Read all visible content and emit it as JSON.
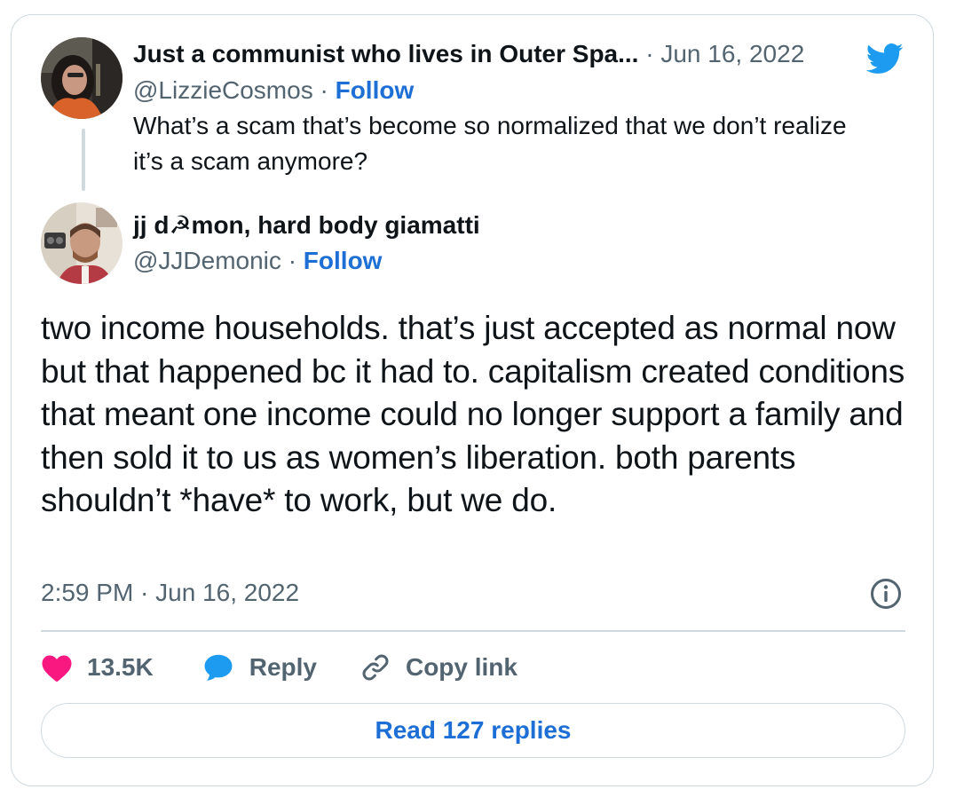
{
  "quoted": {
    "display_name": "Just a communist who lives in Outer Spa...",
    "date": "Jun 16, 2022",
    "handle": "@LizzieCosmos",
    "follow_label": "Follow",
    "text": "What’s a scam that’s become so normalized that  we don’t realize it’s a scam anymore?"
  },
  "tweet": {
    "display_name": "jj d☭mon, hard body giamatti",
    "handle": "@JJDemonic",
    "follow_label": "Follow",
    "text": "two income households. that’s just accepted as normal now but that happened bc it had to. capitalism created conditions that meant one income could no longer support a family and then sold it to us as women’s liberation. both parents shouldn’t *have* to work, but we do.",
    "timestamp": "2:59 PM · Jun 16, 2022"
  },
  "actions": {
    "like_count": "13.5K",
    "reply_label": "Reply",
    "copy_link_label": "Copy link"
  },
  "read_replies_label": "Read 127 replies",
  "separator": "·",
  "colors": {
    "twitter_blue": "#1d9bf0",
    "link_blue": "#1d6fd6",
    "like_pink": "#f91880",
    "secondary_text": "#536471",
    "border": "#cfd9de"
  },
  "icons": {
    "brand": "twitter-bird-icon",
    "info": "info-icon",
    "like": "heart-icon",
    "reply": "speech-bubble-icon",
    "copy_link": "link-icon"
  }
}
